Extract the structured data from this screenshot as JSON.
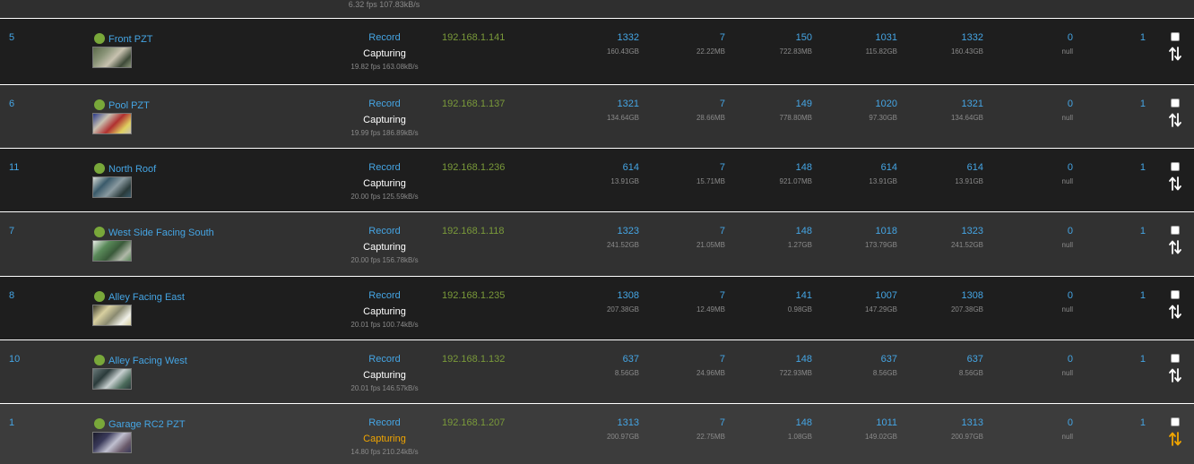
{
  "top": {
    "stats": "6.32 fps 107.83kB/s"
  },
  "rows": [
    {
      "id": "5",
      "name": "Front PZT",
      "mode": "Record",
      "status": "Capturing",
      "stats": "19.82 fps 163.08kB/s",
      "ip": "192.168.1.141",
      "c1": "1332",
      "c1s": "160.43GB",
      "c2": "7",
      "c2s": "22.22MB",
      "c3": "150",
      "c3s": "722.83MB",
      "c4": "1031",
      "c4s": "115.82GB",
      "c5": "1332",
      "c5s": "160.43GB",
      "c6": "0",
      "c6s": "null",
      "c7": "1",
      "warn": false
    },
    {
      "id": "6",
      "name": "Pool PZT",
      "mode": "Record",
      "status": "Capturing",
      "stats": "19.99 fps 186.89kB/s",
      "ip": "192.168.1.137",
      "c1": "1321",
      "c1s": "134.64GB",
      "c2": "7",
      "c2s": "28.66MB",
      "c3": "149",
      "c3s": "778.80MB",
      "c4": "1020",
      "c4s": "97.30GB",
      "c5": "1321",
      "c5s": "134.64GB",
      "c6": "0",
      "c6s": "null",
      "c7": "1",
      "warn": false
    },
    {
      "id": "11",
      "name": "North Roof",
      "mode": "Record",
      "status": "Capturing",
      "stats": "20.00 fps 125.59kB/s",
      "ip": "192.168.1.236",
      "c1": "614",
      "c1s": "13.91GB",
      "c2": "7",
      "c2s": "15.71MB",
      "c3": "148",
      "c3s": "921.07MB",
      "c4": "614",
      "c4s": "13.91GB",
      "c5": "614",
      "c5s": "13.91GB",
      "c6": "0",
      "c6s": "null",
      "c7": "1",
      "warn": false
    },
    {
      "id": "7",
      "name": "West Side Facing South",
      "mode": "Record",
      "status": "Capturing",
      "stats": "20.00 fps 156.78kB/s",
      "ip": "192.168.1.118",
      "c1": "1323",
      "c1s": "241.52GB",
      "c2": "7",
      "c2s": "21.05MB",
      "c3": "148",
      "c3s": "1.27GB",
      "c4": "1018",
      "c4s": "173.79GB",
      "c5": "1323",
      "c5s": "241.52GB",
      "c6": "0",
      "c6s": "null",
      "c7": "1",
      "warn": false
    },
    {
      "id": "8",
      "name": "Alley Facing East",
      "mode": "Record",
      "status": "Capturing",
      "stats": "20.01 fps 100.74kB/s",
      "ip": "192.168.1.235",
      "c1": "1308",
      "c1s": "207.38GB",
      "c2": "7",
      "c2s": "12.49MB",
      "c3": "141",
      "c3s": "0.98GB",
      "c4": "1007",
      "c4s": "147.29GB",
      "c5": "1308",
      "c5s": "207.38GB",
      "c6": "0",
      "c6s": "null",
      "c7": "1",
      "warn": false
    },
    {
      "id": "10",
      "name": "Alley Facing West",
      "mode": "Record",
      "status": "Capturing",
      "stats": "20.01 fps 146.57kB/s",
      "ip": "192.168.1.132",
      "c1": "637",
      "c1s": "8.56GB",
      "c2": "7",
      "c2s": "24.96MB",
      "c3": "148",
      "c3s": "722.93MB",
      "c4": "637",
      "c4s": "8.56GB",
      "c5": "637",
      "c5s": "8.56GB",
      "c6": "0",
      "c6s": "null",
      "c7": "1",
      "warn": false
    },
    {
      "id": "1",
      "name": "Garage RC2 PZT",
      "mode": "Record",
      "status": "Capturing",
      "stats": "14.80 fps 210.24kB/s",
      "ip": "192.168.1.207",
      "c1": "1313",
      "c1s": "200.97GB",
      "c2": "7",
      "c2s": "22.75MB",
      "c3": "148",
      "c3s": "1.08GB",
      "c4": "1011",
      "c4s": "149.02GB",
      "c5": "1313",
      "c5s": "200.97GB",
      "c6": "0",
      "c6s": "null",
      "c7": "1",
      "warn": true
    }
  ],
  "colors": {
    "link": "#45a5e4",
    "ip": "#7a9a3a",
    "online_dot": "#79a83a",
    "warning": "#f0a500"
  },
  "icons": {
    "status": "online-dot-icon",
    "sort": "sort-arrows-icon"
  }
}
